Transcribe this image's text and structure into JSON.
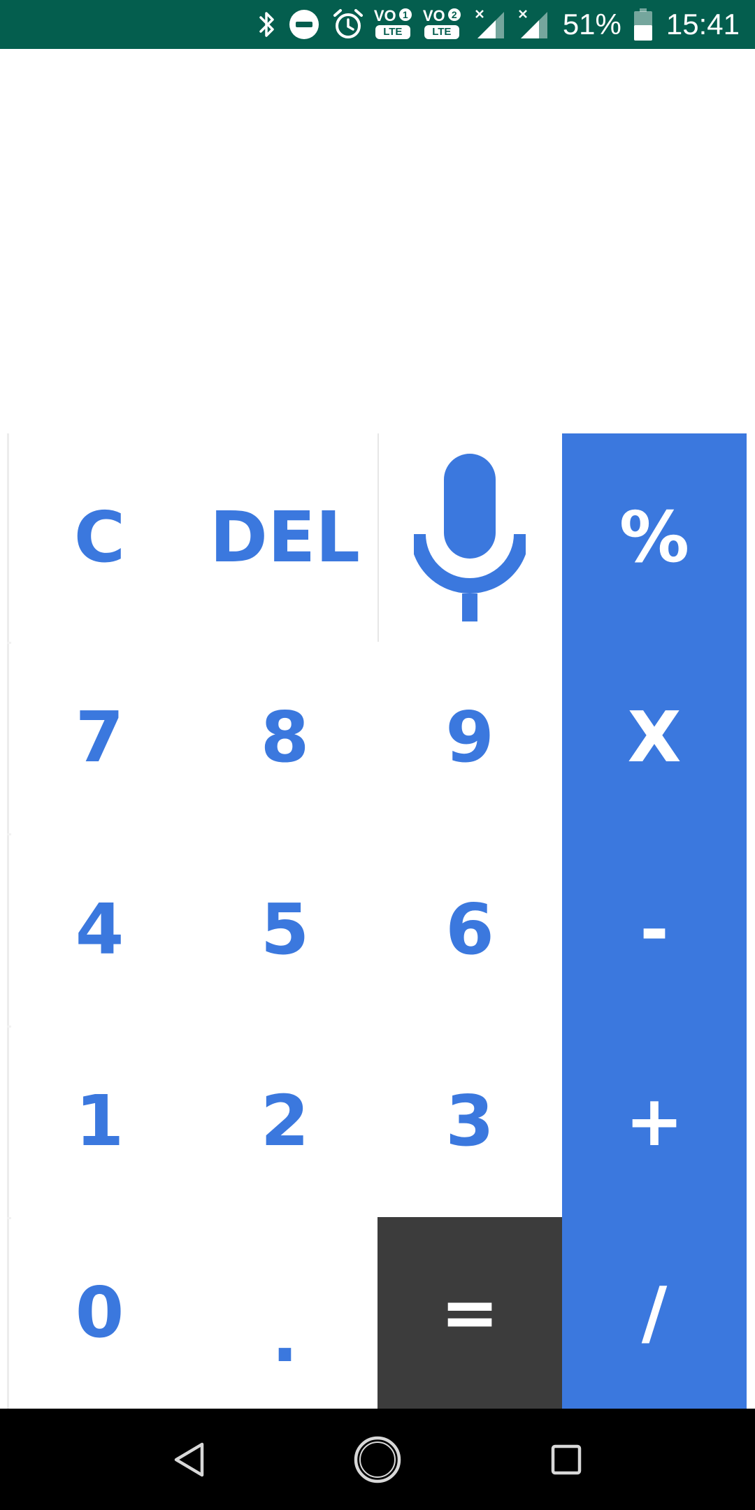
{
  "status_bar": {
    "battery_percent": "51%",
    "time": "15:41",
    "sim1": {
      "vo": "VO",
      "sim_number": "1",
      "network": "LTE"
    },
    "sim2": {
      "vo": "VO",
      "sim_number": "2",
      "network": "LTE"
    },
    "icons": [
      "bluetooth-icon",
      "do-not-disturb-icon",
      "alarm-icon",
      "volte-icon",
      "signal-icon",
      "battery-icon"
    ],
    "background_color": "#045e4e"
  },
  "display": {
    "expression": "",
    "result": ""
  },
  "keypad": {
    "clear": "C",
    "delete": "DEL",
    "voice_input": "microphone-icon",
    "percent": "%",
    "multiply": "X",
    "subtract": "-",
    "add": "+",
    "divide": "/",
    "equals": "=",
    "decimal": ".",
    "digits": [
      "0",
      "1",
      "2",
      "3",
      "4",
      "5",
      "6",
      "7",
      "8",
      "9"
    ]
  },
  "colors": {
    "accent": "#3b78de",
    "equals_background": "#3c3c3c",
    "key_text": "#3b78de",
    "operator_text": "#ffffff",
    "background": "#ffffff"
  },
  "nav_bar": {
    "buttons": [
      "back-icon",
      "home-icon",
      "recents-icon"
    ]
  }
}
